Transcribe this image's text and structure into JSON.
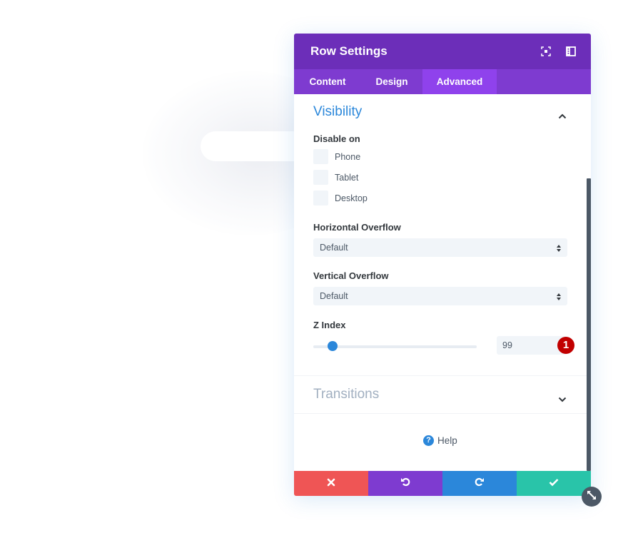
{
  "modal": {
    "title": "Row Settings",
    "header_icons": [
      "focus-icon",
      "split-view-icon"
    ],
    "tabs": [
      {
        "label": "Content",
        "active": false
      },
      {
        "label": "Design",
        "active": false
      },
      {
        "label": "Advanced",
        "active": true
      }
    ]
  },
  "visibility": {
    "title": "Visibility",
    "expanded": true,
    "disable_on_label": "Disable on",
    "options": [
      {
        "label": "Phone",
        "checked": false
      },
      {
        "label": "Tablet",
        "checked": false
      },
      {
        "label": "Desktop",
        "checked": false
      }
    ],
    "horizontal_overflow": {
      "label": "Horizontal Overflow",
      "value": "Default"
    },
    "vertical_overflow": {
      "label": "Vertical Overflow",
      "value": "Default"
    },
    "z_index": {
      "label": "Z Index",
      "value": "99",
      "slider_fraction": 0.12
    }
  },
  "annotation_badge": "1",
  "transitions": {
    "title": "Transitions",
    "expanded": false
  },
  "help": {
    "label": "Help",
    "icon_glyph": "?"
  },
  "footer": {
    "buttons": [
      {
        "name": "discard",
        "color": "#ef5555"
      },
      {
        "name": "undo",
        "color": "#7e3bd0"
      },
      {
        "name": "redo",
        "color": "#2b87da"
      },
      {
        "name": "save",
        "color": "#29c4a9"
      }
    ]
  },
  "colors": {
    "header": "#6c2eb9",
    "tabs": "#7e3bd0",
    "active_tab": "#8f42ec",
    "section_title_active": "#2b87da",
    "section_title_inactive": "#a2b0c1",
    "badge": "#c10000"
  }
}
